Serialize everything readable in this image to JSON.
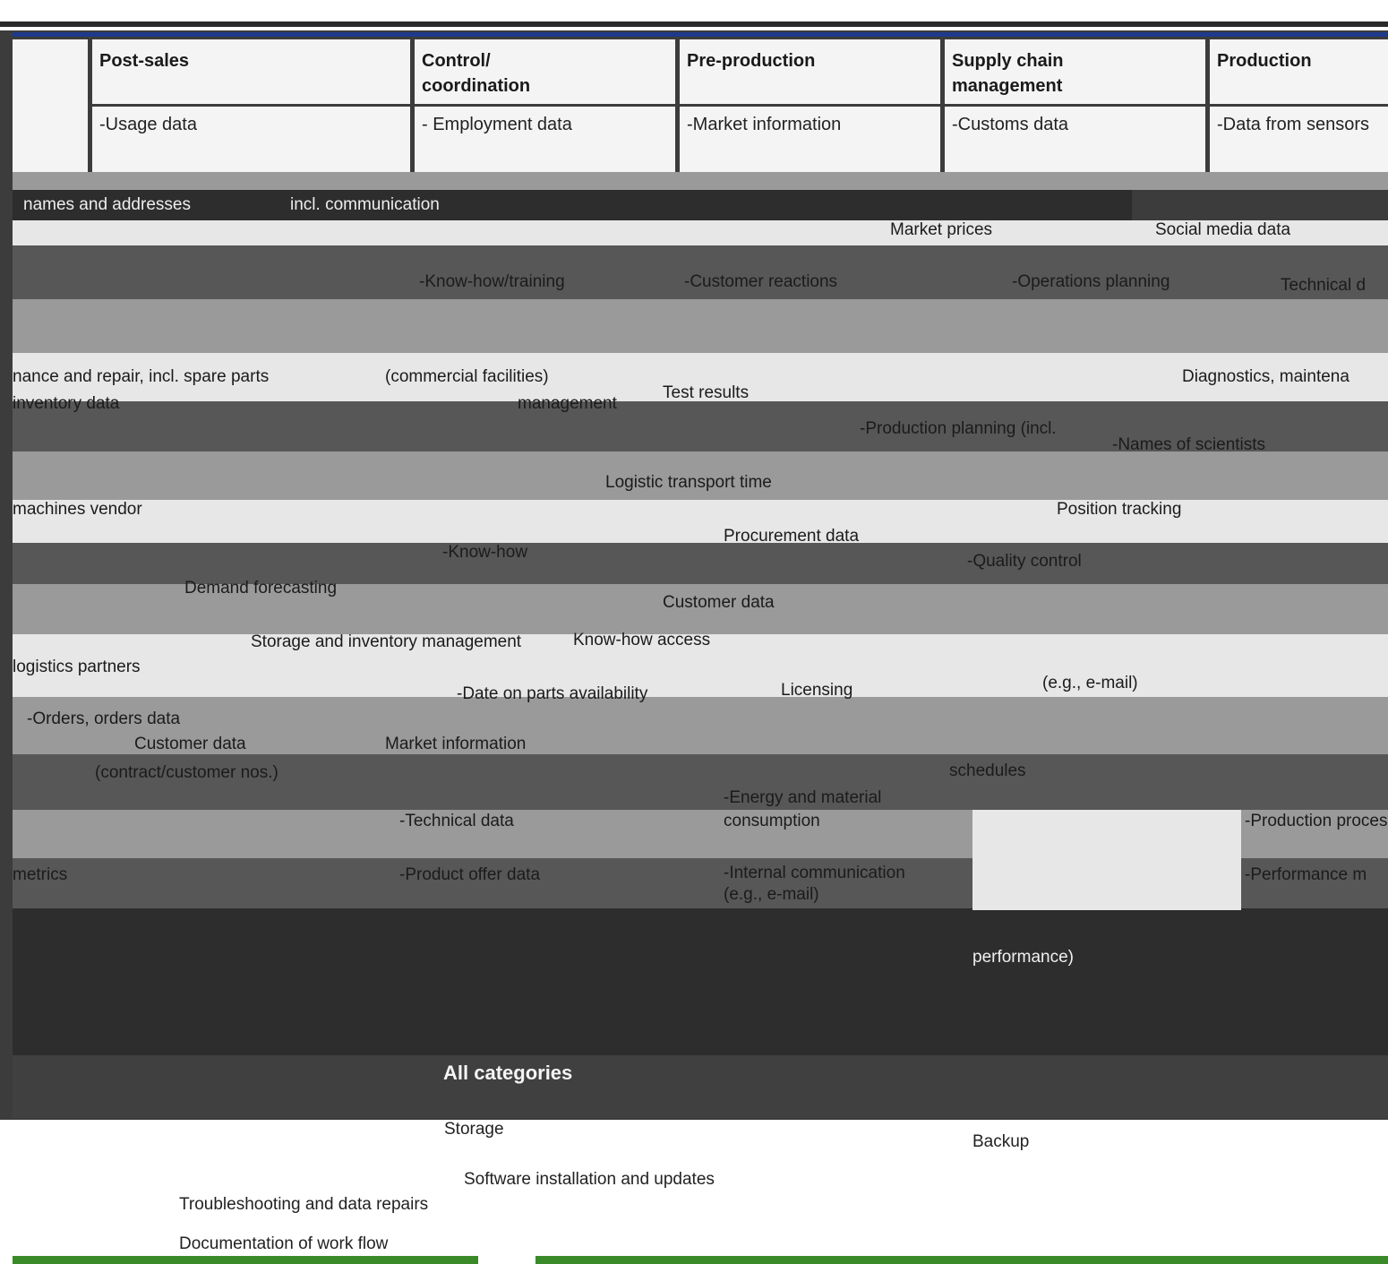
{
  "header": {
    "title": "",
    "columns": [
      {
        "heading": "Post-sales",
        "first_item": "-Usage data"
      },
      {
        "heading": "Control/ coordination",
        "first_item": "- Employment data"
      },
      {
        "heading": "Pre-production",
        "first_item": "-Market information"
      },
      {
        "heading": "Supply chain management",
        "first_item": "-Customs data"
      },
      {
        "heading": "Production",
        "first_item": "-Data from sensors"
      }
    ]
  },
  "items": {
    "names_addresses": "names and addresses",
    "incl_communication": "incl. communication",
    "market_prices": "Market prices",
    "social_media": "Social media data",
    "know_how_training": "-Know-how/training",
    "customer_reactions": "-Customer reactions",
    "operations_planning": "-Operations planning",
    "technical": "Technical d",
    "maintenance_repair": "nance and repair, incl. spare parts",
    "commercial_facilities": "(commercial facilities)",
    "test_results": "Test results",
    "diagnostics": "Diagnostics, maintena",
    "inventory_data": "inventory data",
    "management": "management",
    "production_planning": "-Production planning (incl.",
    "names_scientists": "-Names of scientists",
    "transport_time": "Logistic transport time",
    "machines_vendor": "machines vendor",
    "position_tracking": "Position tracking",
    "know_how": "-Know-how",
    "procurement": "Procurement data",
    "quality_control": "-Quality control",
    "demand_forecast": "Demand forecasting",
    "customer_data_pre": "Customer data",
    "storage_inventory": "Storage and inventory management",
    "know_how_access": "Know-how access",
    "logistics_partners": "logistics partners",
    "external_comm": "(e.g., e-mail)",
    "date_spare_parts": "-Date on parts availability",
    "licensing": "Licensing",
    "orders": "-Orders, orders data",
    "customer_data": "Customer data",
    "market_information": "Market information",
    "contract_customer": "(contract/customer nos.)",
    "schedules": "schedules",
    "energy_material": "-Energy and material",
    "consumption": "consumption",
    "technical_data": "-Technical data",
    "production_process": "-Production process",
    "metrics": "metrics",
    "product_offer": "-Product offer data",
    "internal_comm": "-Internal communication",
    "internal_comm_2": "(e.g., e-mail)",
    "performance": "-Performance m",
    "performance_2": "performance)"
  },
  "categories": {
    "label": "All categories",
    "rows": [
      "Storage",
      "Backup",
      "Software installation and updates",
      "Troubleshooting and data repairs",
      "Documentation of work flow"
    ]
  }
}
